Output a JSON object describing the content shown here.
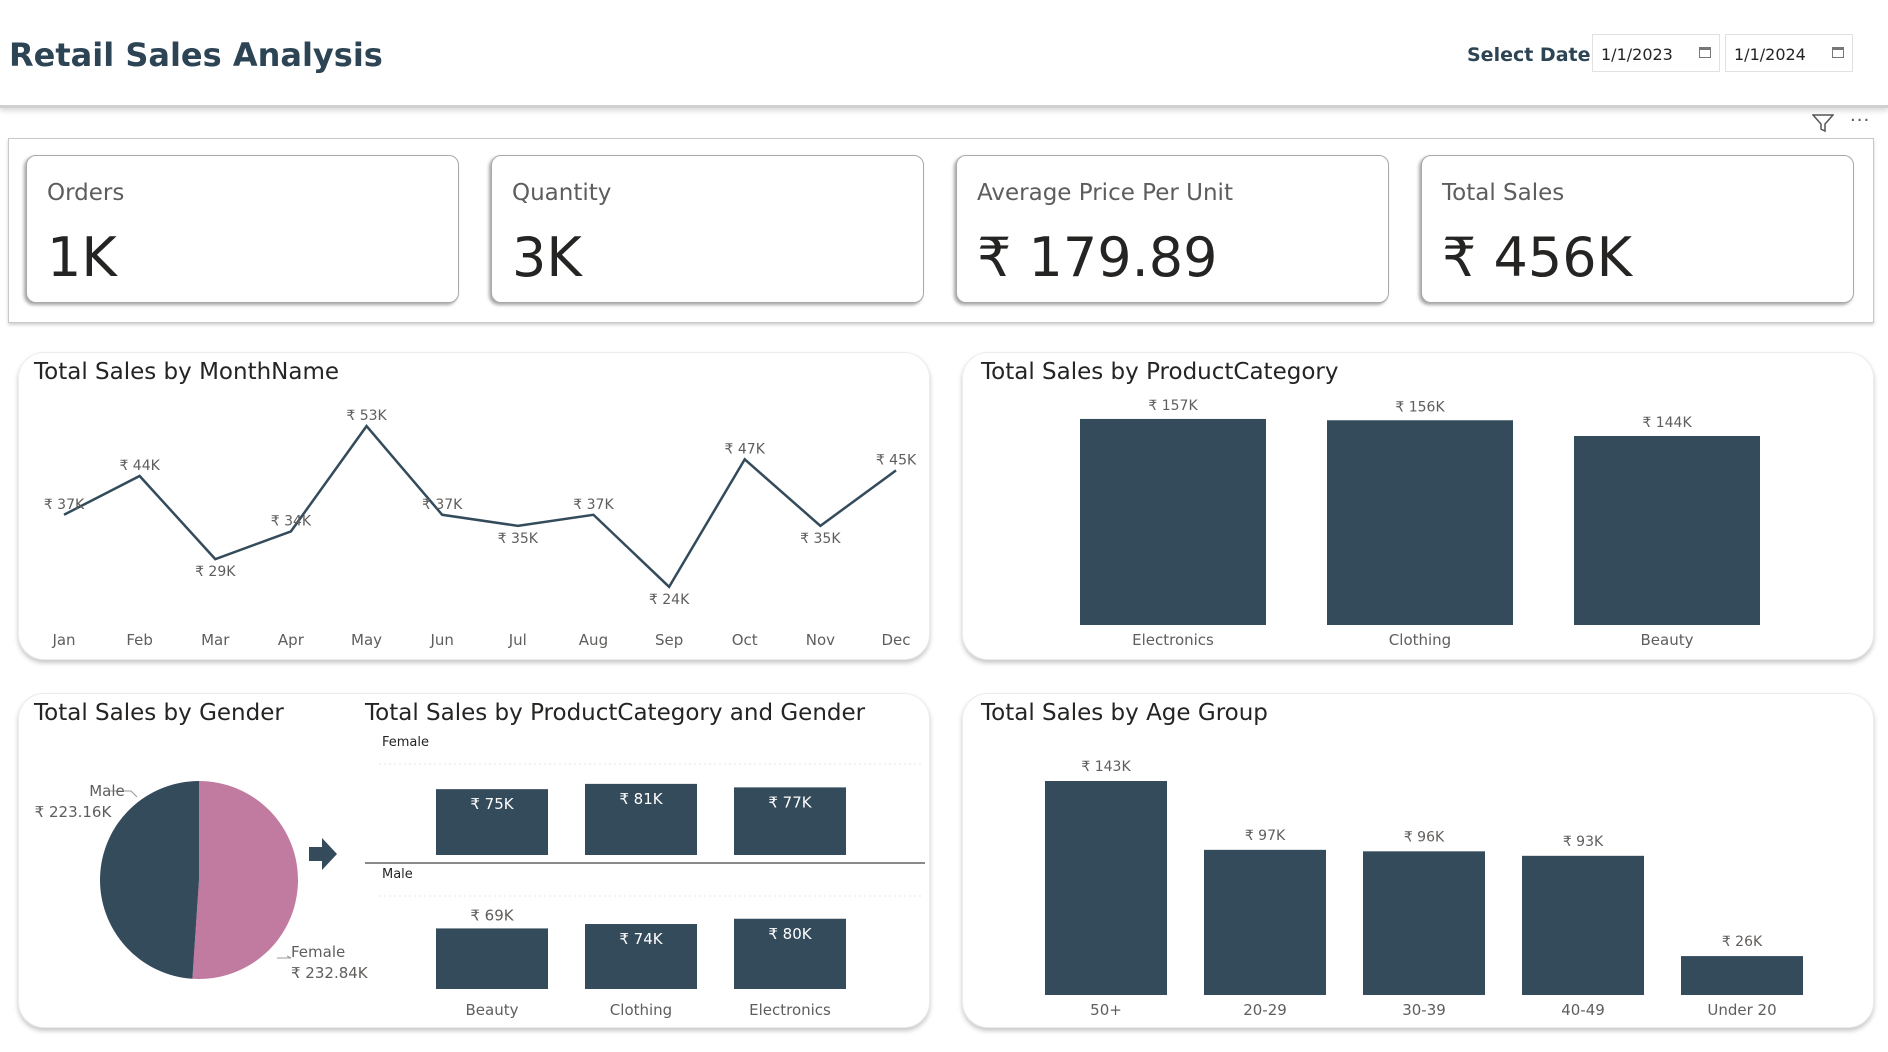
{
  "header": {
    "title": "Retail Sales Analysis",
    "date_label": "Select Date :",
    "start_date": "1/1/2023",
    "end_date": "1/1/2024"
  },
  "toolbar": {
    "more_label": "···"
  },
  "kpis": [
    {
      "label": "Orders",
      "value": "1K"
    },
    {
      "label": "Quantity",
      "value": "3K"
    },
    {
      "label": "Average Price Per Unit",
      "value": "₹ 179.89"
    },
    {
      "label": "Total Sales",
      "value": "₹ 456K"
    }
  ],
  "colors": {
    "primary": "#344b5c",
    "female": "#c27ba0",
    "title": "#2d4455"
  },
  "chart_titles": {
    "month": "Total Sales by MonthName",
    "category": "Total Sales by ProductCategory",
    "gender": "Total Sales by Gender",
    "cat_gender": "Total Sales by ProductCategory and Gender",
    "age": "Total Sales by Age Group"
  },
  "chart_data": [
    {
      "id": "month",
      "type": "line",
      "categories": [
        "Jan",
        "Feb",
        "Mar",
        "Apr",
        "May",
        "Jun",
        "Jul",
        "Aug",
        "Sep",
        "Oct",
        "Nov",
        "Dec"
      ],
      "values": [
        37,
        44,
        29,
        34,
        53,
        37,
        35,
        37,
        24,
        47,
        35,
        45
      ],
      "labels": [
        "₹ 37K",
        "₹ 44K",
        "₹ 29K",
        "₹ 34K",
        "₹ 53K",
        "₹ 37K",
        "₹ 35K",
        "₹ 37K",
        "₹ 24K",
        "₹ 47K",
        "₹ 35K",
        "₹ 45K"
      ],
      "unit": "K"
    },
    {
      "id": "category",
      "type": "bar",
      "categories": [
        "Electronics",
        "Clothing",
        "Beauty"
      ],
      "values": [
        157,
        156,
        144
      ],
      "labels": [
        "₹ 157K",
        "₹ 156K",
        "₹ 144K"
      ]
    },
    {
      "id": "gender",
      "type": "pie",
      "categories": [
        "Male",
        "Female"
      ],
      "values": [
        223.16,
        232.84
      ],
      "labels": [
        "₹ 223.16K",
        "₹ 232.84K"
      ]
    },
    {
      "id": "cat_gender",
      "type": "bar",
      "categories": [
        "Beauty",
        "Clothing",
        "Electronics"
      ],
      "series": [
        {
          "name": "Female",
          "values": [
            75,
            81,
            77
          ],
          "labels": [
            "₹ 75K",
            "₹ 81K",
            "₹ 77K"
          ]
        },
        {
          "name": "Male",
          "values": [
            69,
            74,
            80
          ],
          "labels": [
            "₹ 69K",
            "₹ 74K",
            "₹ 80K"
          ]
        }
      ]
    },
    {
      "id": "age",
      "type": "bar",
      "categories": [
        "50+",
        "20-29",
        "30-39",
        "40-49",
        "Under 20"
      ],
      "values": [
        143,
        97,
        96,
        93,
        26
      ],
      "labels": [
        "₹ 143K",
        "₹ 97K",
        "₹ 96K",
        "₹ 93K",
        "₹ 26K"
      ]
    }
  ]
}
